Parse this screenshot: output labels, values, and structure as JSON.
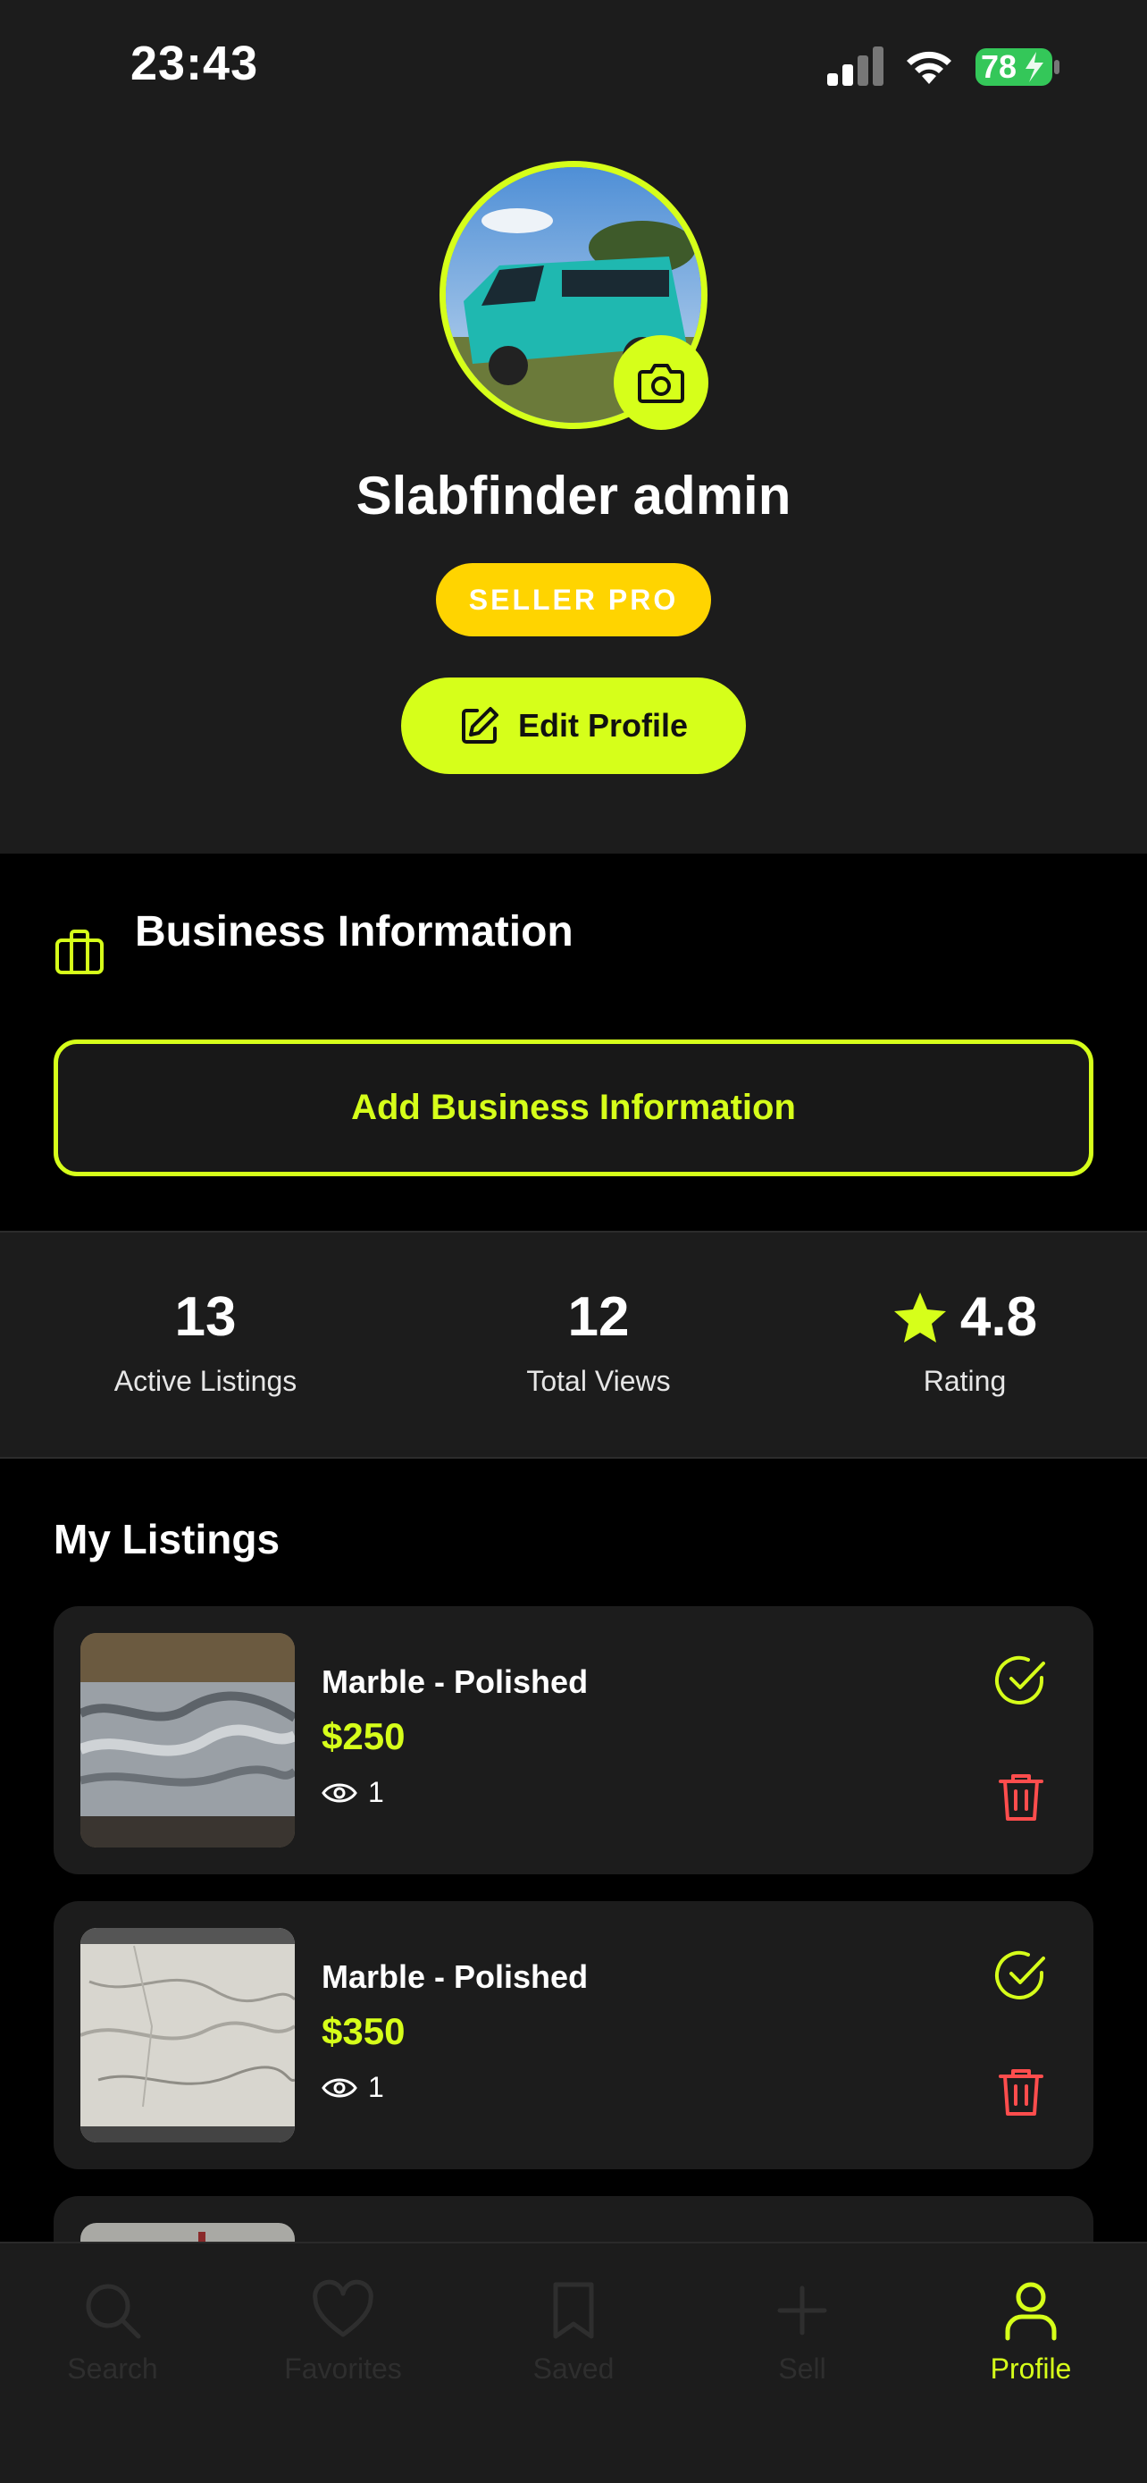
{
  "status": {
    "time": "23:43",
    "battery": "78"
  },
  "profile": {
    "name": "Slabfinder admin",
    "badge": "SELLER PRO",
    "edit_label": "Edit Profile"
  },
  "business": {
    "title": "Business Information",
    "add_label": "Add Business Information"
  },
  "stats": [
    {
      "value": "13",
      "label": "Active Listings"
    },
    {
      "value": "12",
      "label": "Total Views"
    },
    {
      "value": "4.8",
      "label": "Rating"
    }
  ],
  "listings": {
    "title": "My Listings",
    "items": [
      {
        "title": "Marble - Polished",
        "price": "$250",
        "views": "1"
      },
      {
        "title": "Marble - Polished",
        "price": "$350",
        "views": "1"
      }
    ]
  },
  "nav": [
    {
      "label": "Search",
      "icon": "search-icon"
    },
    {
      "label": "Favorites",
      "icon": "heart-icon"
    },
    {
      "label": "Saved",
      "icon": "bookmark-icon"
    },
    {
      "label": "Sell",
      "icon": "plus-icon"
    },
    {
      "label": "Profile",
      "icon": "user-icon"
    }
  ],
  "colors": {
    "accent": "#d6ff1a",
    "badge": "#ffd400",
    "danger": "#ff4d4d",
    "battery": "#34c759"
  }
}
